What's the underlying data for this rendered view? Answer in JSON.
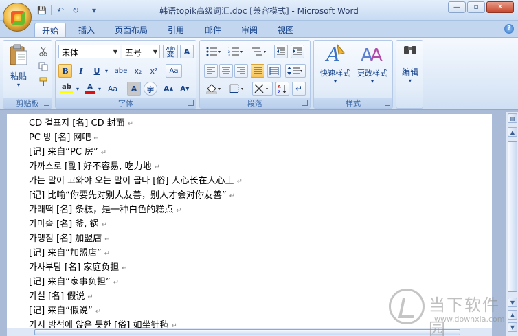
{
  "window": {
    "title": "韩语topik高级词汇.doc [兼容模式] - Microsoft Word",
    "controls": {
      "minimize": "—",
      "restore": "▫",
      "close": "✕"
    }
  },
  "qat": {
    "save": "💾",
    "undo": "↶",
    "redo": "↻",
    "more": "▾"
  },
  "tabs": [
    {
      "label": "开始",
      "active": true
    },
    {
      "label": "插入"
    },
    {
      "label": "页面布局"
    },
    {
      "label": "引用"
    },
    {
      "label": "邮件"
    },
    {
      "label": "审阅"
    },
    {
      "label": "视图"
    }
  ],
  "help": "?",
  "ribbon": {
    "clipboard": {
      "label": "剪贴板",
      "paste": "粘贴"
    },
    "font": {
      "label": "字体",
      "font_name": "宋体",
      "font_size": "五号",
      "wen": "wén",
      "wen_char": "变",
      "A": "A",
      "bold": "B",
      "italic": "I",
      "underline": "U",
      "strike": "abe",
      "sub": "x₂",
      "sup": "x²",
      "clear": "Aa",
      "grow": "A",
      "shrink": "A",
      "char_border": "A",
      "enclose": "字"
    },
    "paragraph": {
      "label": "段落"
    },
    "styles": {
      "label": "样式",
      "quick": "快速样式",
      "change": "更改样式"
    },
    "editing": {
      "label": "编辑"
    }
  },
  "document": {
    "lines": [
      "CD 겉표지 [名] CD 封面",
      "PC 방 [名] 网吧",
      "[记] 来自“PC 房”",
      "가까스로 [副] 好不容易, 吃力地",
      "가는 말이 고와야 오는 말이 곱다 [俗] 人心长在人心上",
      "[记] 比喻“你要先对别人友善，别人才会对你友善”",
      "가래떡 [名] 条糕，是一种白色的糕点",
      "가마솥 [名] 釜, 锅",
      "가맹점 [名] 加盟店",
      "[记] 来自“加盟店”",
      "가사부담 [名] 家庭负担",
      "[记] 来自“家事负担”",
      "가설 [名] 假说",
      "[记] 来自“假说”",
      "가시 방석에 앉은 듯한 [俗] 如坐针毡"
    ],
    "para_mark": "↵"
  },
  "watermark": {
    "cn": "当下软件园",
    "en": "www.downxia.com"
  }
}
